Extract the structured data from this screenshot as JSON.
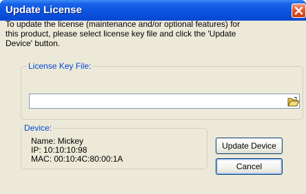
{
  "window": {
    "title": "Update License",
    "close_icon": "close-icon"
  },
  "intro": {
    "lines": [
      "To update the license (maintenance and/or optional features) for",
      "this product, please select license key file and click the 'Update",
      "Device' button."
    ]
  },
  "license_key": {
    "legend": "License Key File:",
    "value": "",
    "browse_icon": "open-folder-icon"
  },
  "device": {
    "legend": "Device:",
    "name": "Name: Mickey",
    "ip": "IP: 10:10:10:98",
    "mac": "MAC: 00:10:4C:80:00:1A"
  },
  "buttons": {
    "update": "Update Device",
    "cancel": "Cancel"
  },
  "colors": {
    "titlebar": "#0a53e0",
    "client": "#ece9d8",
    "legend_text": "#0046d5",
    "close_button": "#e2582f"
  }
}
